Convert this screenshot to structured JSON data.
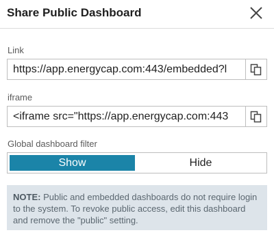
{
  "dialog": {
    "title": "Share Public Dashboard"
  },
  "link": {
    "label": "Link",
    "value": "https://app.energycap.com:443/embedded?l"
  },
  "iframe": {
    "label": "iframe",
    "value": "<iframe src=\"https://app.energycap.com:443"
  },
  "filter": {
    "label": "Global dashboard filter",
    "options": [
      "Show",
      "Hide"
    ],
    "selected": "Show"
  },
  "note": {
    "prefix": "NOTE:",
    "text": " Public and embedded dashboards do not require login to the system. To revoke public access, edit this dashboard and remove the \"public\" setting."
  },
  "colors": {
    "accent": "#1b84a8",
    "note_bg": "#dde4ea"
  },
  "icons": {
    "close": "close-icon",
    "copy": "copy-icon"
  }
}
